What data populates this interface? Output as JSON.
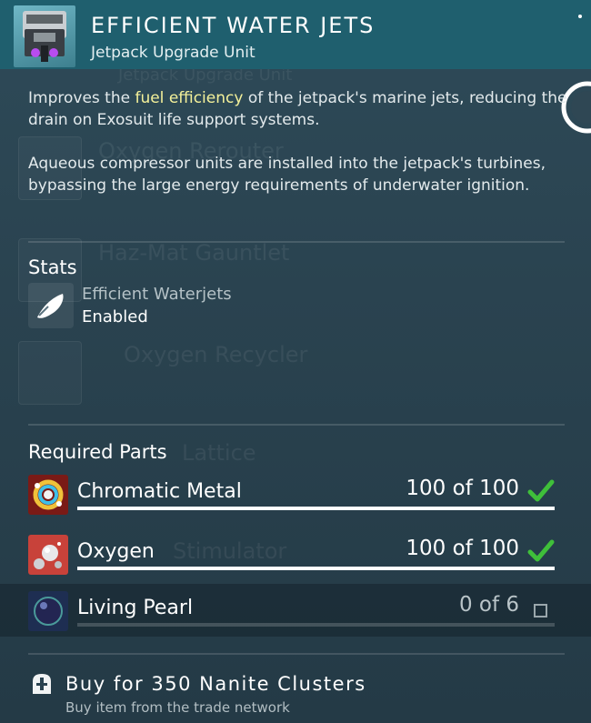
{
  "header": {
    "title": "EFFICIENT WATER JETS",
    "subtitle": "Jetpack Upgrade Unit",
    "icon": "jetpack-module-icon"
  },
  "description": {
    "para1_before": "Improves the ",
    "para1_highlight": "fuel efficiency",
    "para1_after": " of the jetpack's marine jets, reducing the drain on Exosuit life support systems.",
    "para2": "Aqueous compressor units are installed into the jetpack's turbines, bypassing the large energy requirements of underwater ignition."
  },
  "stats": {
    "heading": "Stats",
    "items": [
      {
        "name": "Efficient Waterjets",
        "value": "Enabled",
        "icon": "waterjet-icon"
      }
    ]
  },
  "required_parts": {
    "heading": "Required Parts",
    "items": [
      {
        "name": "Chromatic Metal",
        "amount": "100 of 100",
        "have": 100,
        "need": 100,
        "complete": true,
        "icon": "chromatic-metal-icon",
        "color": "#7a1a16"
      },
      {
        "name": "Oxygen",
        "amount": "100 of 100",
        "have": 100,
        "need": 100,
        "complete": true,
        "icon": "oxygen-icon",
        "color": "#c8423a"
      },
      {
        "name": "Living Pearl",
        "amount": "0 of 6",
        "have": 0,
        "need": 6,
        "complete": false,
        "icon": "living-pearl-icon",
        "color": "#1e2e52"
      }
    ]
  },
  "buy": {
    "label": "Buy for 350 Nanite Clusters",
    "sub": "Buy item from the trade network",
    "icon": "trade-network-icon"
  },
  "colors": {
    "header_bg": "#1f5f6e",
    "panel_bg": "#2a4250",
    "highlight": "#f4f19a",
    "check": "#3fbf3a"
  }
}
